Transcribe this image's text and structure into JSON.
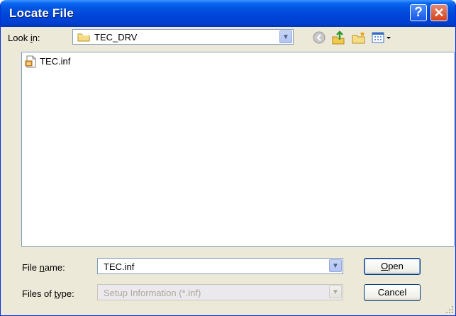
{
  "window": {
    "title": "Locate File"
  },
  "titlebar": {
    "help_glyph": "?",
    "close_glyph": "✕"
  },
  "lookin": {
    "label_pre": "Look ",
    "label_accel": "i",
    "label_post": "n:",
    "value": "TEC_DRV",
    "icon": "folder-icon"
  },
  "toolbar": [
    "back-icon",
    "up-folder-icon",
    "new-folder-icon",
    "view-menu-icon"
  ],
  "files": [
    {
      "name": "TEC.inf",
      "icon": "inf-file-icon"
    }
  ],
  "filename": {
    "label_pre": "File ",
    "label_accel": "n",
    "label_post": "ame:",
    "value": "TEC.inf"
  },
  "filetype": {
    "label_pre": "Files of ",
    "label_accel": "t",
    "label_post": "ype:",
    "value": "Setup Information (*.inf)"
  },
  "buttons": {
    "open": {
      "accel": "O",
      "rest": "pen"
    },
    "cancel": "Cancel"
  },
  "colors": {
    "titlebar": "#0044d8",
    "close": "#d5421b",
    "dialog_bg": "#ece9d8",
    "field_border": "#7f9db9"
  }
}
